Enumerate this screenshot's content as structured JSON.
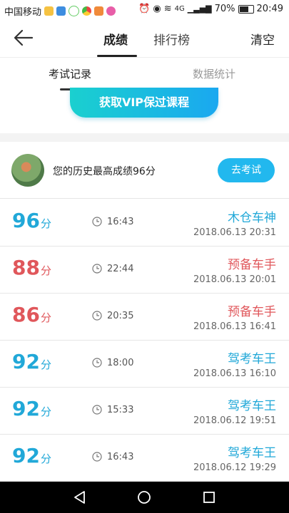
{
  "status_bar": {
    "carrier": "中国移动",
    "app_icons": [
      "mail-app-icon",
      "store-app-icon",
      "wechat-app-icon",
      "chrome-app-icon",
      "assistant-app-icon",
      "game-app-icon"
    ],
    "signal_label": "4G",
    "battery": "70%",
    "time": "20:49"
  },
  "header": {
    "tabs": [
      "成绩",
      "排行榜"
    ],
    "active_tab": 0,
    "clear_label": "清空"
  },
  "subtabs": {
    "items": [
      "考试记录",
      "数据统计"
    ],
    "active": 0
  },
  "vip_button": "获取VIP保过课程",
  "best_score": {
    "text": "您的历史最高成绩96分",
    "exam_button": "去考试"
  },
  "records": [
    {
      "score": "96",
      "unit": "分",
      "duration": "16:43",
      "rank": "木仓车神",
      "datetime": "2018.06.13 20:31",
      "color": "#21a8d8"
    },
    {
      "score": "88",
      "unit": "分",
      "duration": "22:44",
      "rank": "预备车手",
      "datetime": "2018.06.13 20:01",
      "color": "#e0575b"
    },
    {
      "score": "86",
      "unit": "分",
      "duration": "20:35",
      "rank": "预备车手",
      "datetime": "2018.06.13 16:41",
      "color": "#e0575b"
    },
    {
      "score": "92",
      "unit": "分",
      "duration": "18:00",
      "rank": "驾考车王",
      "datetime": "2018.06.13 16:10",
      "color": "#21a8d8"
    },
    {
      "score": "92",
      "unit": "分",
      "duration": "15:33",
      "rank": "驾考车王",
      "datetime": "2018.06.12 19:51",
      "color": "#21a8d8"
    },
    {
      "score": "92",
      "unit": "分",
      "duration": "16:43",
      "rank": "驾考车王",
      "datetime": "2018.06.12 19:29",
      "color": "#21a8d8"
    }
  ]
}
